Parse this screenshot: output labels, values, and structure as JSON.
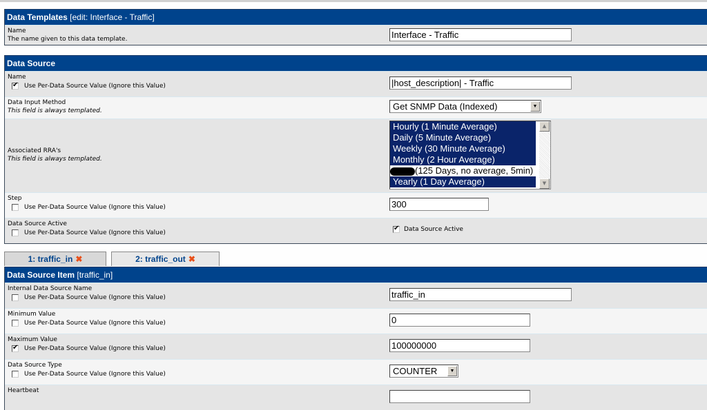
{
  "data_templates": {
    "title": "Data Templates",
    "subtitle": "[edit: Interface - Traffic]",
    "name_label": "Name",
    "name_desc": "The name given to this data template.",
    "name_value": "Interface - Traffic"
  },
  "data_source": {
    "title": "Data Source",
    "per_ds_label": "Use Per-Data Source Value (Ignore this Value)",
    "always_templated": "This field is always templated.",
    "name": {
      "label": "Name",
      "checked": true,
      "value": "|host_description| - Traffic"
    },
    "input_method": {
      "label": "Data Input Method",
      "value": "Get SNMP Data (Indexed)"
    },
    "rras": {
      "label": "Associated RRA's",
      "options": [
        {
          "text": "Hourly (1 Minute Average)",
          "selected": true
        },
        {
          "text": "Daily (5 Minute Average)",
          "selected": true
        },
        {
          "text": "Weekly (30 Minute Average)",
          "selected": true
        },
        {
          "text": "Monthly (2 Hour Average)",
          "selected": true
        },
        {
          "text": "(125 Days, no average, 5min)",
          "selected": false,
          "redacted_prefix": true
        },
        {
          "text": "Yearly (1 Day Average)",
          "selected": true
        }
      ]
    },
    "step": {
      "label": "Step",
      "checked": false,
      "value": "300"
    },
    "active": {
      "label": "Data Source Active",
      "checked": false,
      "value_checked": true,
      "value_label": "Data Source Active"
    }
  },
  "tabs": [
    {
      "label": "1: traffic_in",
      "active": true
    },
    {
      "label": "2: traffic_out",
      "active": false
    }
  ],
  "ds_item": {
    "title": "Data Source Item",
    "subtitle": "[traffic_in]",
    "internal_name": {
      "label": "Internal Data Source Name",
      "checked": false,
      "value": "traffic_in"
    },
    "min": {
      "label": "Minimum Value",
      "checked": false,
      "value": "0"
    },
    "max": {
      "label": "Maximum Value",
      "checked": true,
      "value": "100000000"
    },
    "type": {
      "label": "Data Source Type",
      "checked": false,
      "value": "COUNTER"
    },
    "heartbeat": {
      "label": "Heartbeat"
    }
  }
}
